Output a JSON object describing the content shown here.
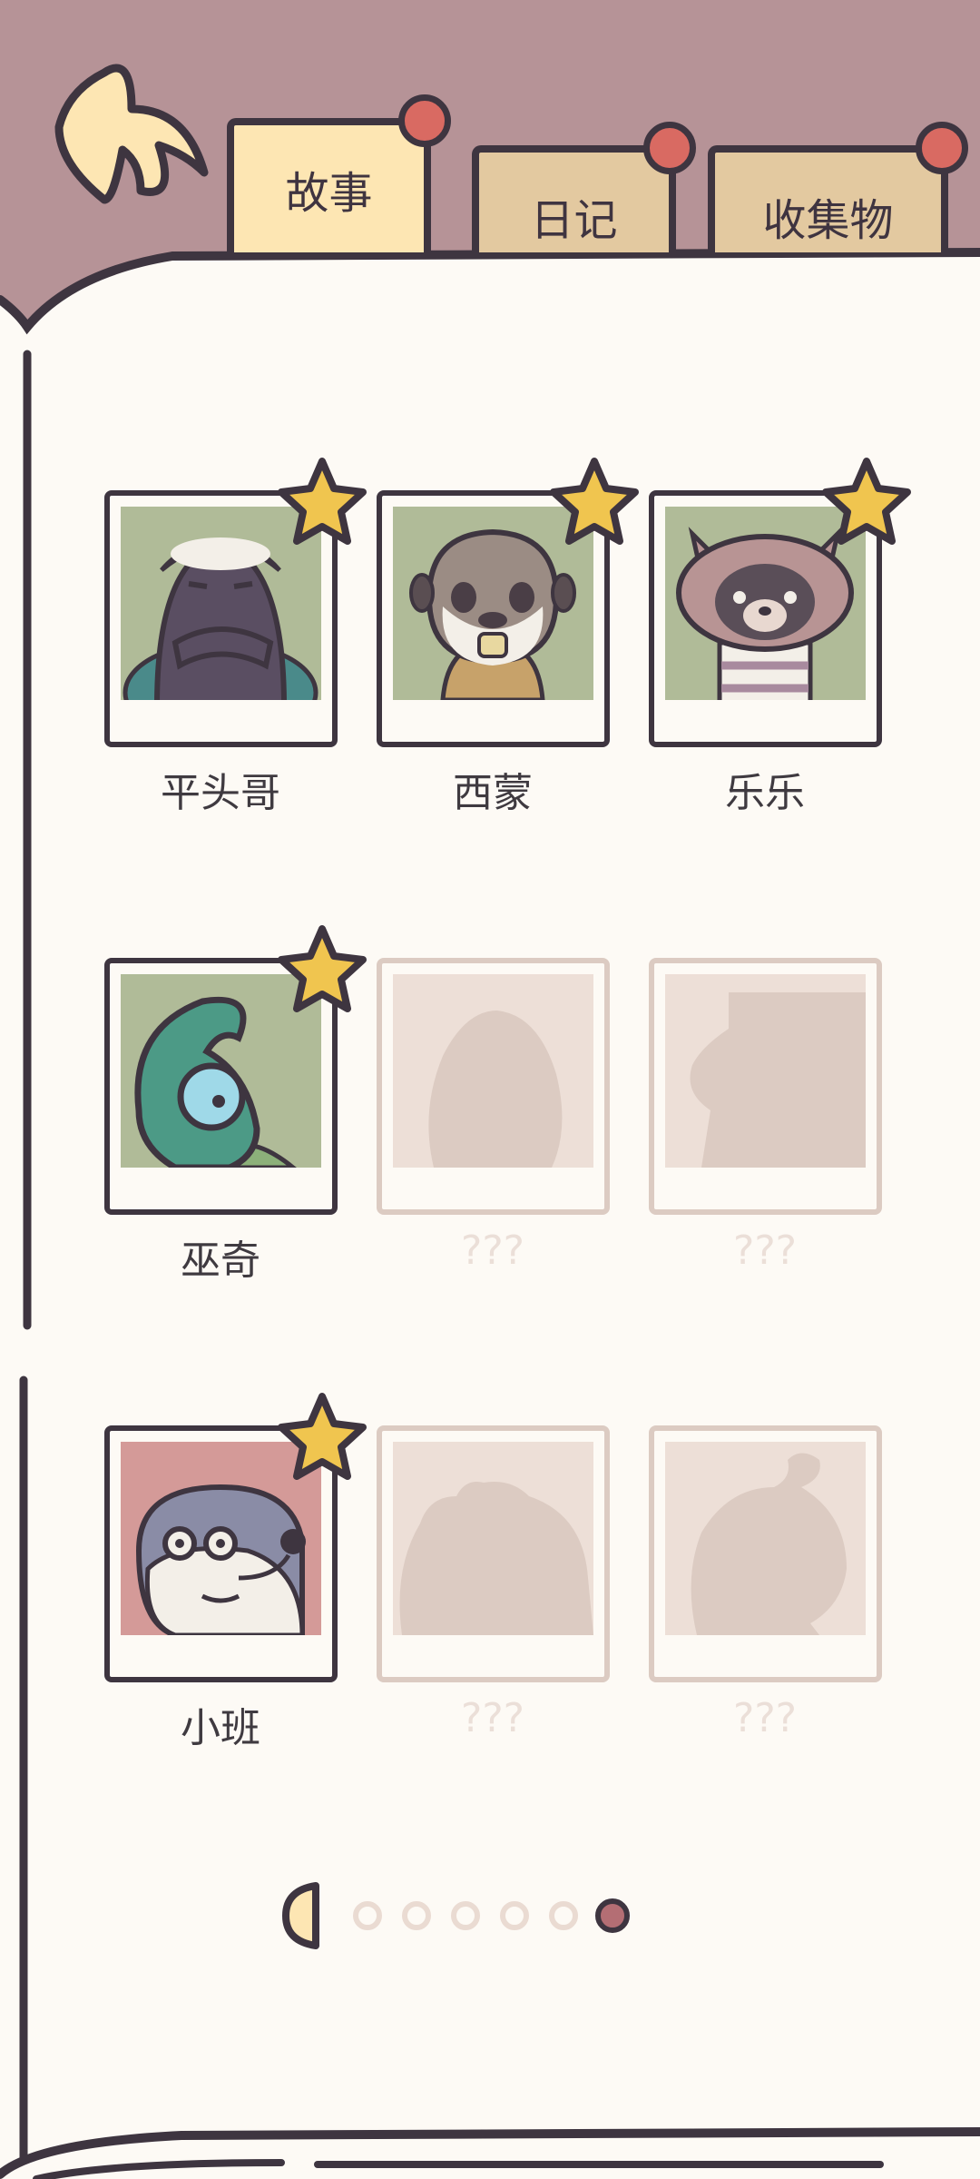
{
  "colors": {
    "header": "#b69397",
    "paper": "#fdfaf5",
    "ink": "#3e3540",
    "tab_active": "#fde6b3",
    "tab_inactive": "#e3c9a0",
    "pin": "#d96a62",
    "star": "#f0c54f",
    "locked": "#eddfd7"
  },
  "back_button": {
    "icon": "back-arrow-icon"
  },
  "tabs": [
    {
      "label": "故事",
      "active": true
    },
    {
      "label": "日记",
      "active": false
    },
    {
      "label": "收集物",
      "active": false
    }
  ],
  "characters": [
    {
      "name": "平头哥",
      "unlocked": true,
      "starred": true,
      "bg": "#b0bb98",
      "icon": "honey-badger-portrait"
    },
    {
      "name": "西蒙",
      "unlocked": true,
      "starred": true,
      "bg": "#b0bb98",
      "icon": "meerkat-portrait"
    },
    {
      "name": "乐乐",
      "unlocked": true,
      "starred": true,
      "bg": "#b0bb98",
      "icon": "raccoon-portrait"
    },
    {
      "name": "巫奇",
      "unlocked": true,
      "starred": true,
      "bg": "#b0bb98",
      "icon": "chameleon-portrait"
    },
    {
      "name": "???",
      "unlocked": false,
      "starred": false,
      "icon": "silhouette-egg"
    },
    {
      "name": "???",
      "unlocked": false,
      "starred": false,
      "icon": "silhouette-creature"
    },
    {
      "name": "小班",
      "unlocked": true,
      "starred": true,
      "bg": "#d49a98",
      "icon": "otter-portrait"
    },
    {
      "name": "???",
      "unlocked": false,
      "starred": false,
      "icon": "silhouette-bear"
    },
    {
      "name": "???",
      "unlocked": false,
      "starred": false,
      "icon": "silhouette-sprout"
    }
  ],
  "pagination": {
    "pages": 6,
    "current": 6,
    "prev_icon": "half-moon-prev-icon"
  }
}
